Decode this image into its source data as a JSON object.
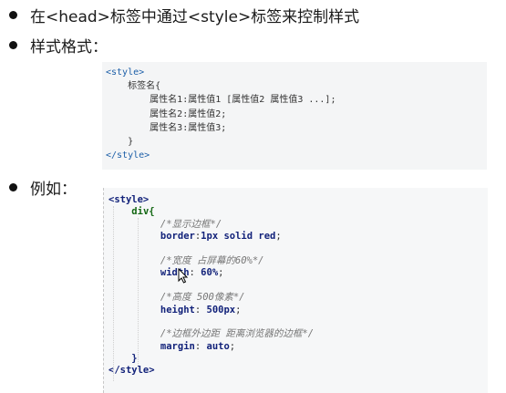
{
  "bullets": [
    {
      "text": "在<head>标签中通过<style>标签来控制样式"
    },
    {
      "text": "样式格式："
    },
    {
      "text": "例如："
    }
  ],
  "code_format": {
    "open_tag": "<style>",
    "selector_line": "标签名{",
    "prop_lines": [
      "属性名1:属性值1 [属性值2 属性值3 ...];",
      "属性名2:属性值2;",
      "属性名3:属性值3;"
    ],
    "close_brace": "}",
    "close_tag": "</style>"
  },
  "code_example": {
    "open_tag": "<style>",
    "selector": "div{",
    "blocks": [
      {
        "comment": "/*显示边框*/",
        "prop": "border",
        "sep": ":",
        "value": "1px solid red",
        "end": ";"
      },
      {
        "comment": "/*宽度 占屏幕的60%*/",
        "prop": "width",
        "sep": ": ",
        "value": "60%",
        "end": ";"
      },
      {
        "comment": "/*高度 500像素*/",
        "prop": "height",
        "sep": ": ",
        "value": "500px",
        "end": ";"
      },
      {
        "comment": "/*边框外边距 距离浏览器的边框*/",
        "prop": "margin",
        "sep": ": ",
        "value": "auto",
        "end": ";"
      }
    ],
    "close_brace": "}",
    "close_tag": "</style>"
  },
  "colors": {
    "tag": "#1d5fa8",
    "selector": "#1f7a1f",
    "property": "#12227a",
    "comment": "#777777",
    "code_bg": "#f4f5f6"
  }
}
